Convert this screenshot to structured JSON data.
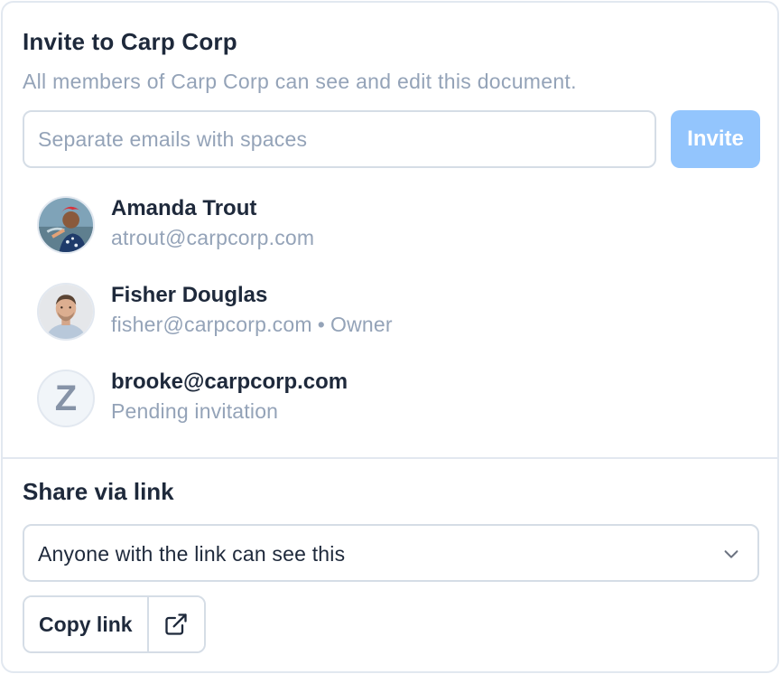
{
  "invite": {
    "title": "Invite to Carp Corp",
    "subtitle": "All members of Carp Corp can see and edit this document.",
    "email_placeholder": "Separate emails with spaces",
    "invite_button": "Invite",
    "invite_button_color": "#93c5fd"
  },
  "members": [
    {
      "name": "Amanda Trout",
      "email": "atrout@carpcorp.com",
      "role": "",
      "avatar": "photo"
    },
    {
      "name": "Fisher Douglas",
      "email": "fisher@carpcorp.com",
      "role": "Owner",
      "separator": "•",
      "avatar": "photo"
    },
    {
      "name": "brooke@carpcorp.com",
      "email": "Pending invitation",
      "role": "",
      "avatar": "initial",
      "initial": "Z"
    }
  ],
  "share": {
    "title": "Share via link",
    "link_setting": "Anyone with the link can see this",
    "copy_button": "Copy link",
    "external_icon": "external-link-icon",
    "chevron_icon": "chevron-down-icon"
  }
}
